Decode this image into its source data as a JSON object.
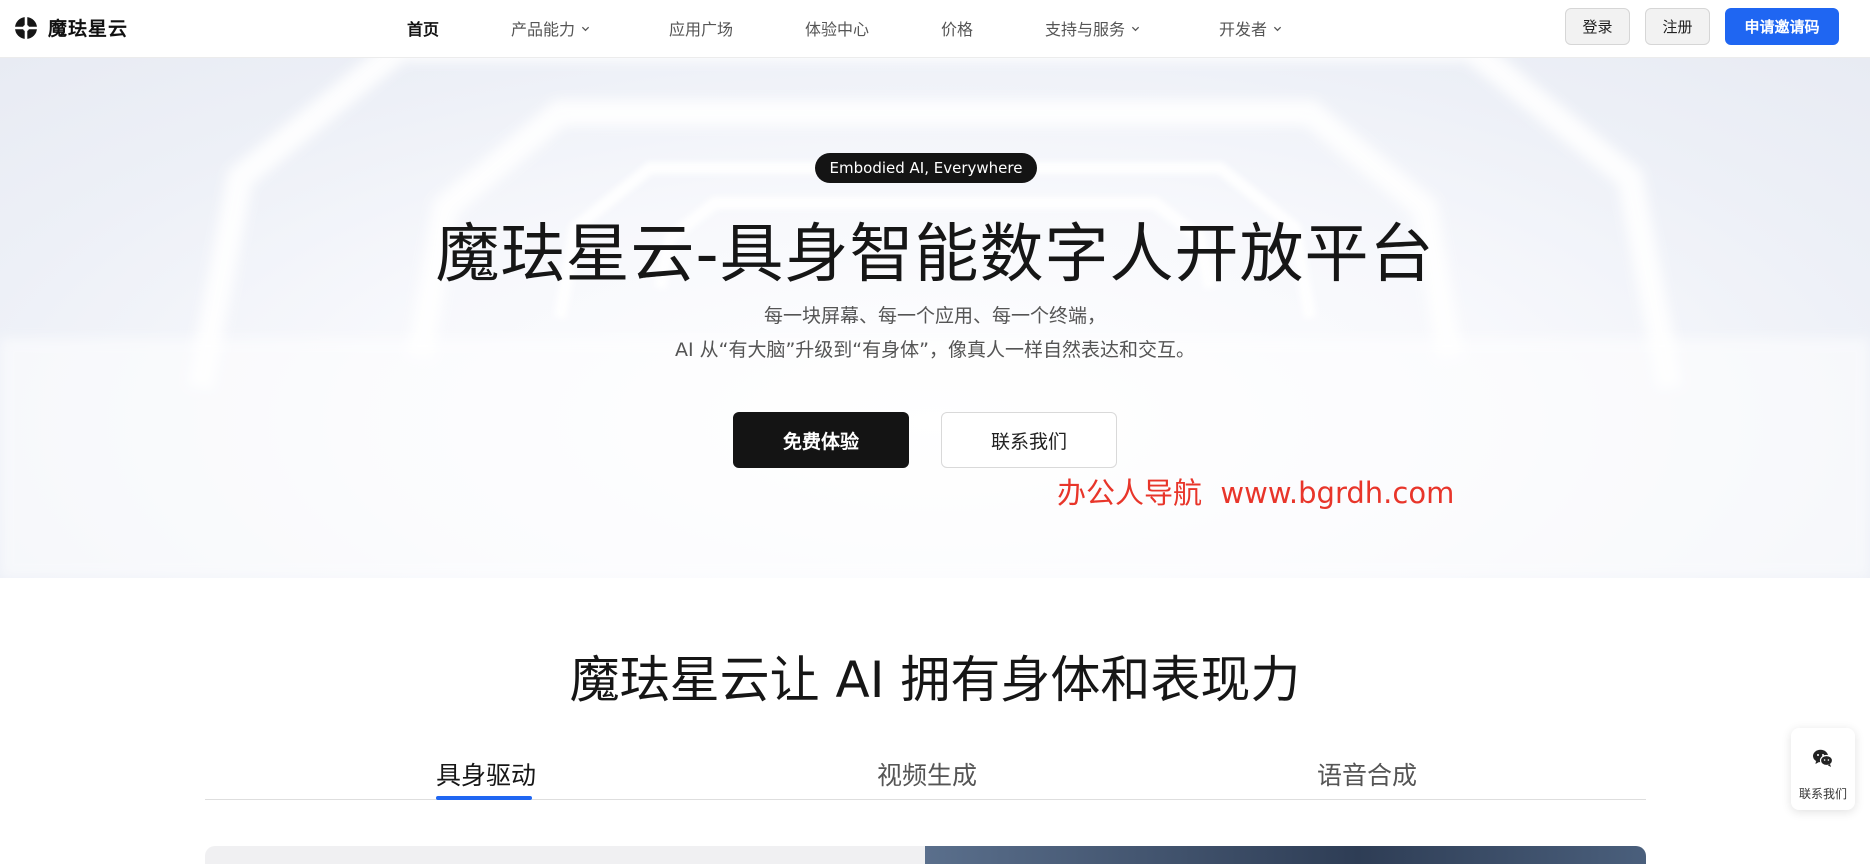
{
  "header": {
    "logo_text": "魔珐星云",
    "nav": [
      {
        "label": "首页",
        "active": true,
        "dropdown": false
      },
      {
        "label": "产品能力",
        "active": false,
        "dropdown": true
      },
      {
        "label": "应用广场",
        "active": false,
        "dropdown": false
      },
      {
        "label": "体验中心",
        "active": false,
        "dropdown": false
      },
      {
        "label": "价格",
        "active": false,
        "dropdown": false
      },
      {
        "label": "支持与服务",
        "active": false,
        "dropdown": true
      },
      {
        "label": "开发者",
        "active": false,
        "dropdown": true
      }
    ],
    "login_label": "登录",
    "register_label": "注册",
    "invite_label": "申请邀请码"
  },
  "hero": {
    "tag": "Embodied AI, Everywhere",
    "title": "魔珐星云-具身智能数字人开放平台",
    "subtitle_line1": "每一块屏幕、每一个应用、每一个终端，",
    "subtitle_line2": "AI 从“有大脑”升级到“有身体”，像真人一样自然表达和交互。",
    "primary_cta": "免费体验",
    "secondary_cta": "联系我们",
    "watermark": "办公人导航  www.bgrdh.com"
  },
  "section": {
    "title": "魔珐星云让 AI 拥有身体和表现力",
    "tabs": [
      {
        "label": "具身驱动",
        "active": true
      },
      {
        "label": "视频生成",
        "active": false
      },
      {
        "label": "语音合成",
        "active": false
      }
    ]
  },
  "float_contact": {
    "label": "联系我们",
    "icon": "wechat-icon"
  },
  "colors": {
    "accent": "#1f66f2",
    "dark": "#141414",
    "watermark": "#e8352a"
  }
}
